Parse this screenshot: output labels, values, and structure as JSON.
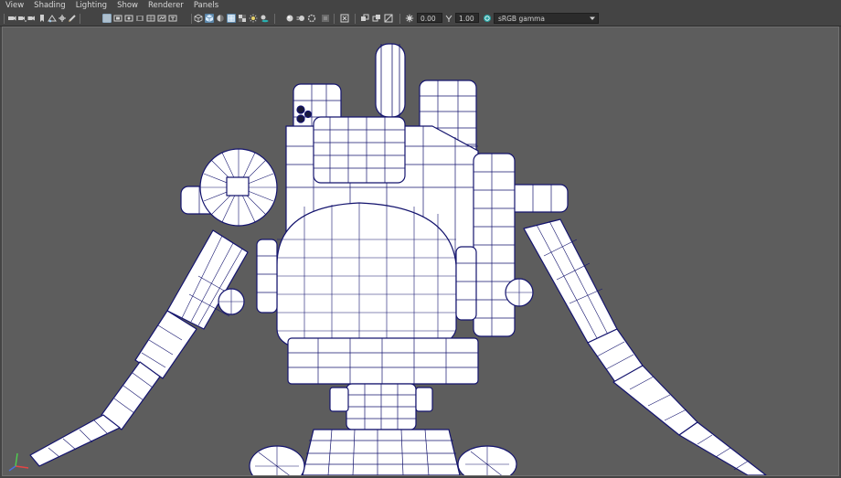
{
  "menu": {
    "items": [
      "View",
      "Shading",
      "Lighting",
      "Show",
      "Renderer",
      "Panels"
    ]
  },
  "toolbar": {
    "exposure_value": "0.00",
    "gamma_value": "1.00",
    "color_space": "sRGB gamma",
    "icons": [
      "camera-attributes-icon",
      "bookmark-icon",
      "image-plane-icon",
      "grease-pencil-icon",
      "snap-icon",
      "grid-icon",
      "film-gate-icon",
      "resolution-gate-icon",
      "gate-mask-icon",
      "field-chart-icon",
      "safe-action-icon",
      "safe-title-icon",
      "wireframe-icon",
      "smooth-shade-icon",
      "default-material-icon",
      "wireframe-on-shaded-icon",
      "textured-icon",
      "use-all-lights-icon",
      "shadows-icon",
      "screen-space-ao-icon",
      "motion-blur-icon",
      "multisample-aa-icon",
      "depth-of-field-icon",
      "isolate-select-icon",
      "xray-icon",
      "xray-active-components-icon",
      "xray-joints-icon",
      "backface-culling-icon",
      "exposure-icon",
      "gamma-icon",
      "color-management-icon"
    ]
  },
  "viewport": {
    "background": "#5d5d5d",
    "wire_color": "#14146e",
    "model_color": "#ffffff",
    "gizmo_colors": {
      "x": "#e64545",
      "y": "#4fd04f",
      "z": "#4a6fe0"
    }
  }
}
